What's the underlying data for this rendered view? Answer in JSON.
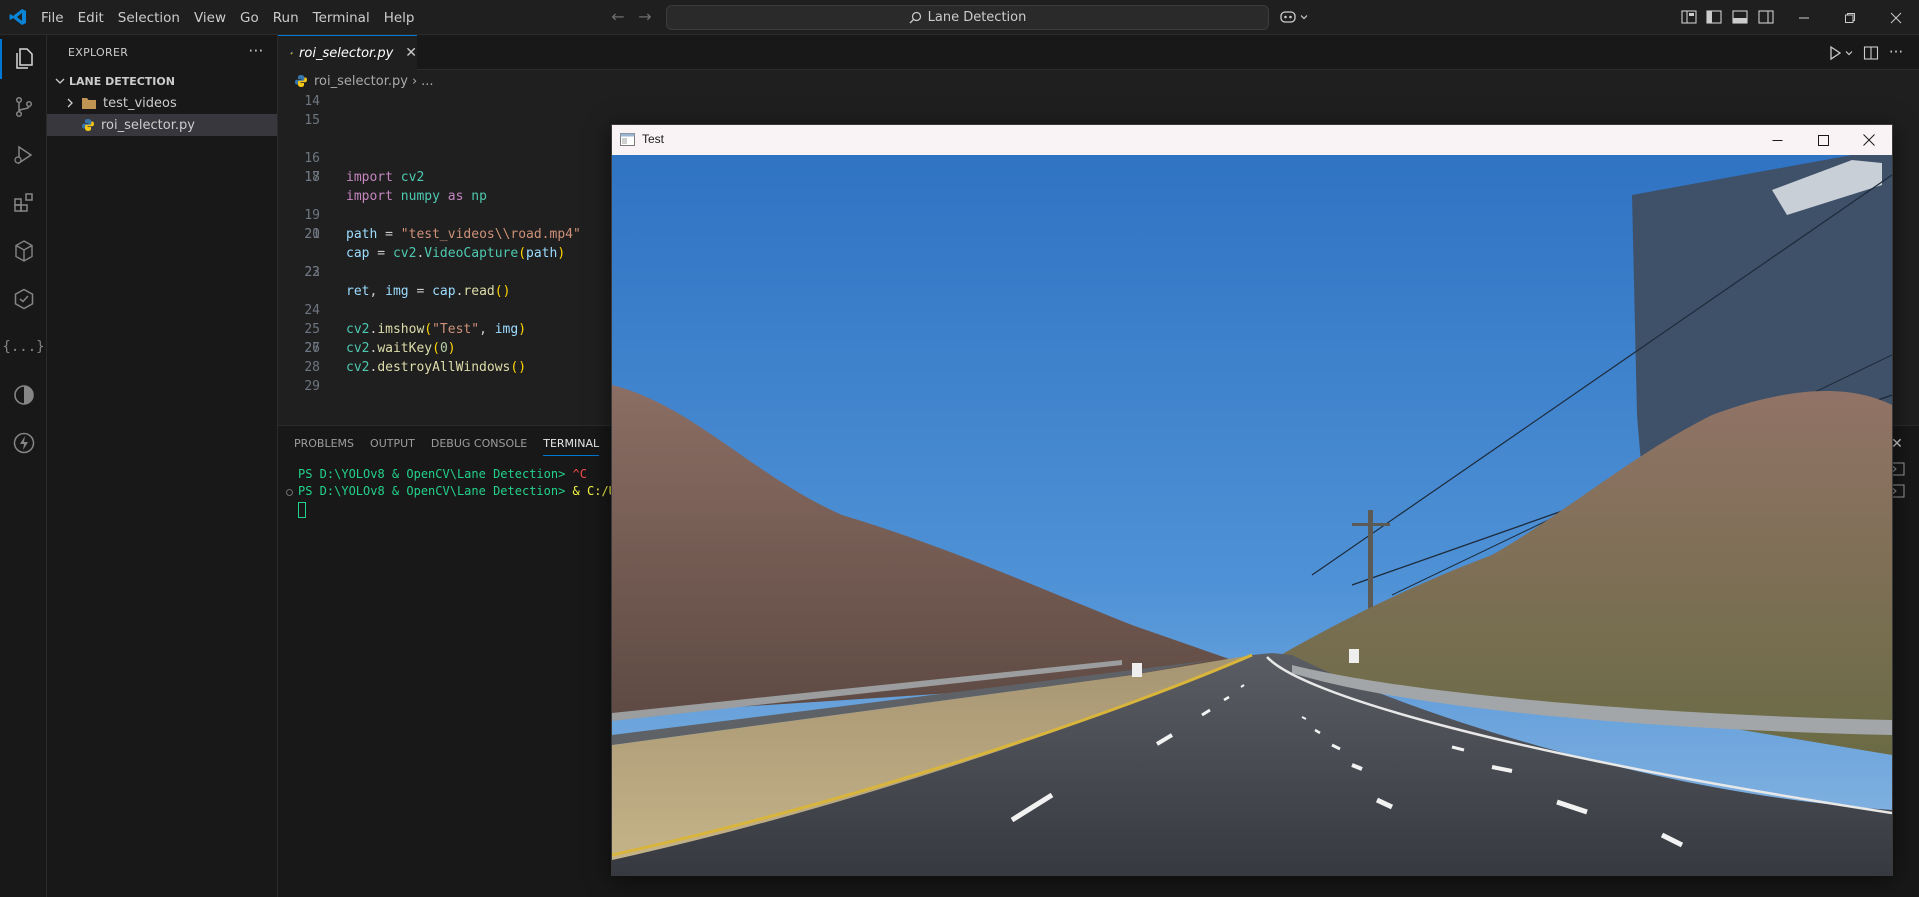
{
  "menubar": {
    "items": [
      "File",
      "Edit",
      "Selection",
      "View",
      "Go",
      "Run",
      "Terminal",
      "Help"
    ]
  },
  "search": {
    "text": "Lane Detection"
  },
  "sidebar": {
    "title": "EXPLORER",
    "workspace": "LANE DETECTION",
    "tree": [
      {
        "label": "test_videos",
        "type": "folder"
      },
      {
        "label": "roi_selector.py",
        "type": "python-file",
        "selected": true
      }
    ]
  },
  "editor": {
    "tab_label": "roi_selector.py",
    "breadcrumb_file": "roi_selector.py",
    "breadcrumb_more": "...",
    "line_numbers": [
      "14",
      "15",
      "16",
      "17",
      "18",
      "19",
      "20",
      "21",
      "22",
      "23",
      "24",
      "25",
      "26",
      "27",
      "28",
      "29"
    ],
    "code": {
      "l16": {
        "kw": "import",
        "mod": "cv2"
      },
      "l17": {
        "kw1": "import",
        "mod": "numpy",
        "kw2": "as",
        "alias": "np"
      },
      "l19": {
        "var": "path",
        "op": " = ",
        "str": "\"test_videos\\\\road.mp4\""
      },
      "l20": {
        "var": "cap",
        "op": " = ",
        "mod": "cv2",
        "dot": ".",
        "fn": "VideoCapture",
        "open": "(",
        "arg": "path",
        "close": ")"
      },
      "l22": {
        "var1": "ret",
        "comma": ", ",
        "var2": "img",
        "op": " = ",
        "obj": "cap",
        "dot": ".",
        "fn": "read",
        "open": "(",
        "close": ")"
      },
      "l24": {
        "mod": "cv2",
        "dot": ".",
        "fn": "imshow",
        "open": "(",
        "str": "\"Test\"",
        "comma": ", ",
        "arg": "img",
        "close": ")"
      },
      "l25": {
        "mod": "cv2",
        "dot": ".",
        "fn": "waitKey",
        "open": "(",
        "num": "0",
        "close": ")"
      },
      "l26": {
        "mod": "cv2",
        "dot": ".",
        "fn": "destroyAllWindows",
        "open": "(",
        "close": ")"
      }
    }
  },
  "panel": {
    "tabs": [
      "PROBLEMS",
      "OUTPUT",
      "DEBUG CONSOLE",
      "TERMINAL"
    ],
    "active_tab": "TERMINAL",
    "terminal": [
      {
        "prompt": "PS D:\\YOLOv8 & OpenCV\\Lane Detection> ",
        "cmd": "^C"
      },
      {
        "prompt": "PS D:\\YOLOv8 & OpenCV\\Lane Detection> ",
        "cmd": "& C:/Us"
      }
    ]
  },
  "cv_window": {
    "title": "Test",
    "image_description_icon": "road-scene"
  },
  "colors": {
    "accent": "#0078d4",
    "editor_bg": "#1f1f1f",
    "sidebar_bg": "#181818"
  }
}
